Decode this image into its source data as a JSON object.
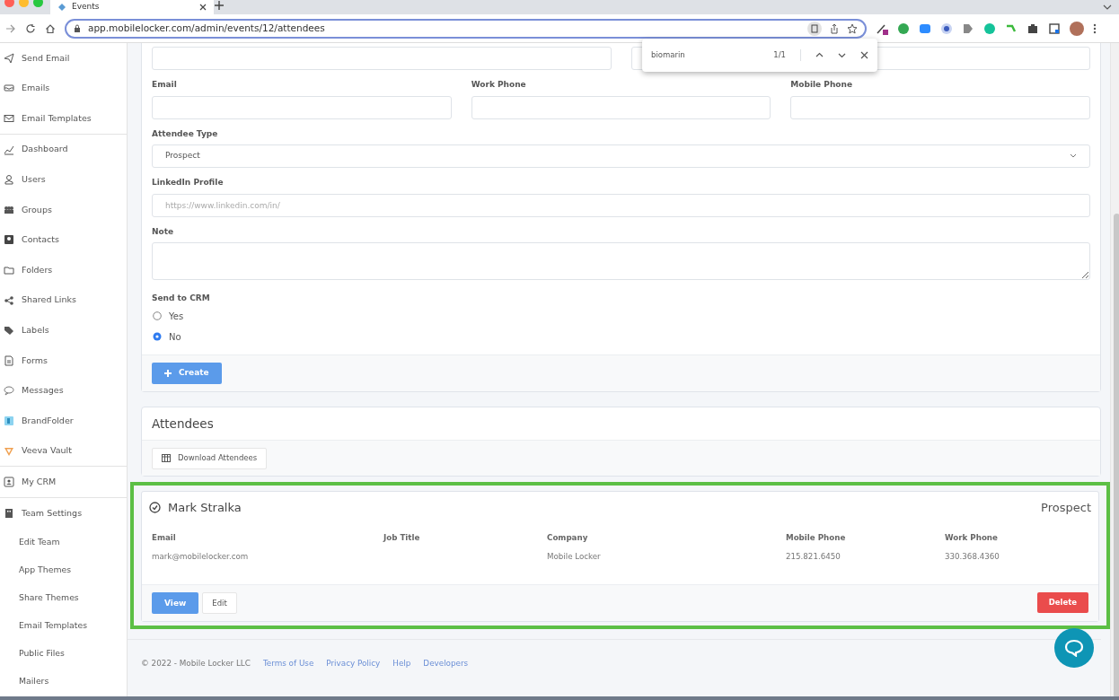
{
  "browser": {
    "tab_title": "Events",
    "url": "app.mobilelocker.com/admin/events/12/attendees",
    "find_bar": {
      "query": "biomarin",
      "count": "1/1"
    }
  },
  "sidebar": {
    "sections": [
      [
        {
          "label": "Send Email",
          "kind": "main"
        },
        {
          "label": "Emails",
          "kind": "main"
        },
        {
          "label": "Email Templates",
          "kind": "main"
        }
      ],
      [
        {
          "label": "Dashboard",
          "kind": "main"
        },
        {
          "label": "Users",
          "kind": "main"
        },
        {
          "label": "Groups",
          "kind": "main"
        },
        {
          "label": "Contacts",
          "kind": "main"
        },
        {
          "label": "Folders",
          "kind": "main"
        },
        {
          "label": "Shared Links",
          "kind": "main"
        },
        {
          "label": "Labels",
          "kind": "main"
        },
        {
          "label": "Forms",
          "kind": "main"
        },
        {
          "label": "Messages",
          "kind": "main"
        },
        {
          "label": "BrandFolder",
          "kind": "main"
        },
        {
          "label": "Veeva Vault",
          "kind": "main"
        }
      ],
      [
        {
          "label": "My CRM",
          "kind": "main"
        }
      ],
      [
        {
          "label": "Team Settings",
          "kind": "main"
        },
        {
          "label": "Edit Team",
          "kind": "sub"
        },
        {
          "label": "App Themes",
          "kind": "sub"
        },
        {
          "label": "Share Themes",
          "kind": "sub"
        },
        {
          "label": "Email Templates",
          "kind": "sub"
        },
        {
          "label": "Public Files",
          "kind": "sub"
        },
        {
          "label": "Mailers",
          "kind": "sub"
        }
      ]
    ]
  },
  "form": {
    "rows": [
      [
        {
          "kind": "input"
        },
        {
          "kind": "input"
        }
      ],
      [
        {
          "kind": "input",
          "label": "Email"
        },
        {
          "kind": "input",
          "label": "Work Phone"
        },
        {
          "kind": "input",
          "label": "Mobile Phone"
        }
      ],
      [
        {
          "kind": "select",
          "label": "Attendee Type",
          "value": "Prospect"
        }
      ],
      [
        {
          "kind": "input",
          "label": "LinkedIn Profile",
          "placeholder": "https://www.linkedin.com/in/"
        }
      ],
      [
        {
          "kind": "textarea",
          "label": "Note"
        }
      ],
      [
        {
          "kind": "radio",
          "label": "Send to CRM",
          "options": [
            {
              "label": "Yes",
              "selected": false
            },
            {
              "label": "No",
              "selected": true
            }
          ]
        }
      ]
    ],
    "submit": "Create"
  },
  "attendees": {
    "title": "Attendees",
    "download": "Download Attendees",
    "items": [
      {
        "name": "Mark Stralka",
        "type": "Prospect",
        "highlighted": true,
        "fields": [
          {
            "label": "Email",
            "value": "mark@mobilelocker.com"
          },
          {
            "label": "Job Title"
          },
          {
            "label": "Company",
            "value": "Mobile Locker"
          },
          {
            "label": "Mobile Phone",
            "value": "215.821.6450"
          },
          {
            "label": "Work Phone",
            "value": "330.368.4360"
          }
        ],
        "actions": {
          "view": "View",
          "edit": "Edit",
          "delete": "Delete"
        }
      }
    ]
  },
  "footer": {
    "copyright": "© 2022 - Mobile Locker LLC",
    "links": [
      "Terms of Use",
      "Privacy Policy",
      "Help",
      "Developers"
    ]
  }
}
